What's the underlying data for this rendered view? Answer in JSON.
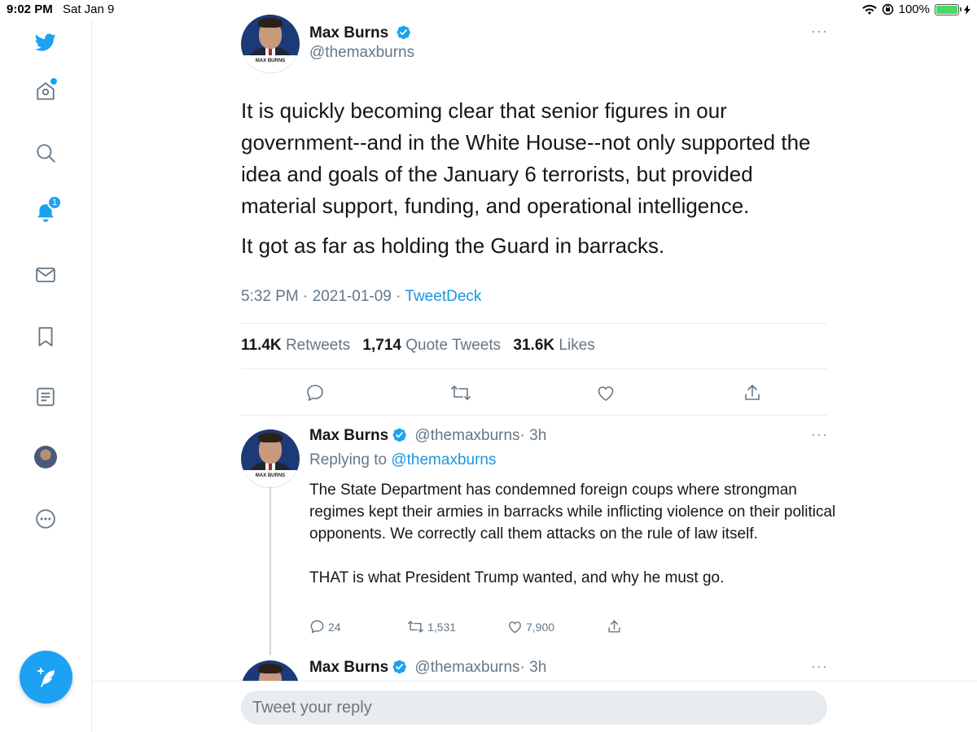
{
  "status_bar": {
    "time": "9:02 PM",
    "date": "Sat Jan 9",
    "battery": "100%"
  },
  "sidebar": {
    "notification_count": "1"
  },
  "tweet": {
    "name": "Max Burns",
    "handle": "@themaxburns",
    "paragraphs": [
      "It is quickly becoming clear that senior figures in our government--and in the White House--not only supported the idea and goals of the January 6 terrorists, but provided material support, funding, and operational intelligence.",
      "It got as far as holding the Guard in barracks."
    ],
    "time": "5:32 PM",
    "sep1": " · ",
    "date": "2021-01-09",
    "sep2": " · ",
    "source": "TweetDeck",
    "retweets_count": "11.4K",
    "retweets_label": "Retweets",
    "quotes_count": "1,714",
    "quotes_label": "Quote Tweets",
    "likes_count": "31.6K",
    "likes_label": "Likes"
  },
  "reply": {
    "name": "Max Burns",
    "handle": "@themaxburns",
    "time_ago": "· 3h",
    "replying_to_label": "Replying to",
    "replying_to_handle": "@themaxburns",
    "paragraphs": [
      "The State Department has condemned foreign coups where strongman regimes kept their armies in barracks while inflicting violence on their political opponents. We correctly call them attacks on the rule of law itself.",
      "THAT is what President Trump wanted, and why he must go."
    ],
    "reply_count": "24",
    "retweet_count": "1,531",
    "like_count": "7,900"
  },
  "next_reply": {
    "name": "Max Burns",
    "handle": "@themaxburns",
    "time_ago": "· 3h"
  },
  "avatar_banner": "MAX BURNS",
  "reply_box": {
    "placeholder": "Tweet your reply"
  },
  "colors": {
    "accent": "#1da1f2",
    "link": "#1b95e0",
    "muted": "#657786",
    "battery": "#4cd964"
  }
}
